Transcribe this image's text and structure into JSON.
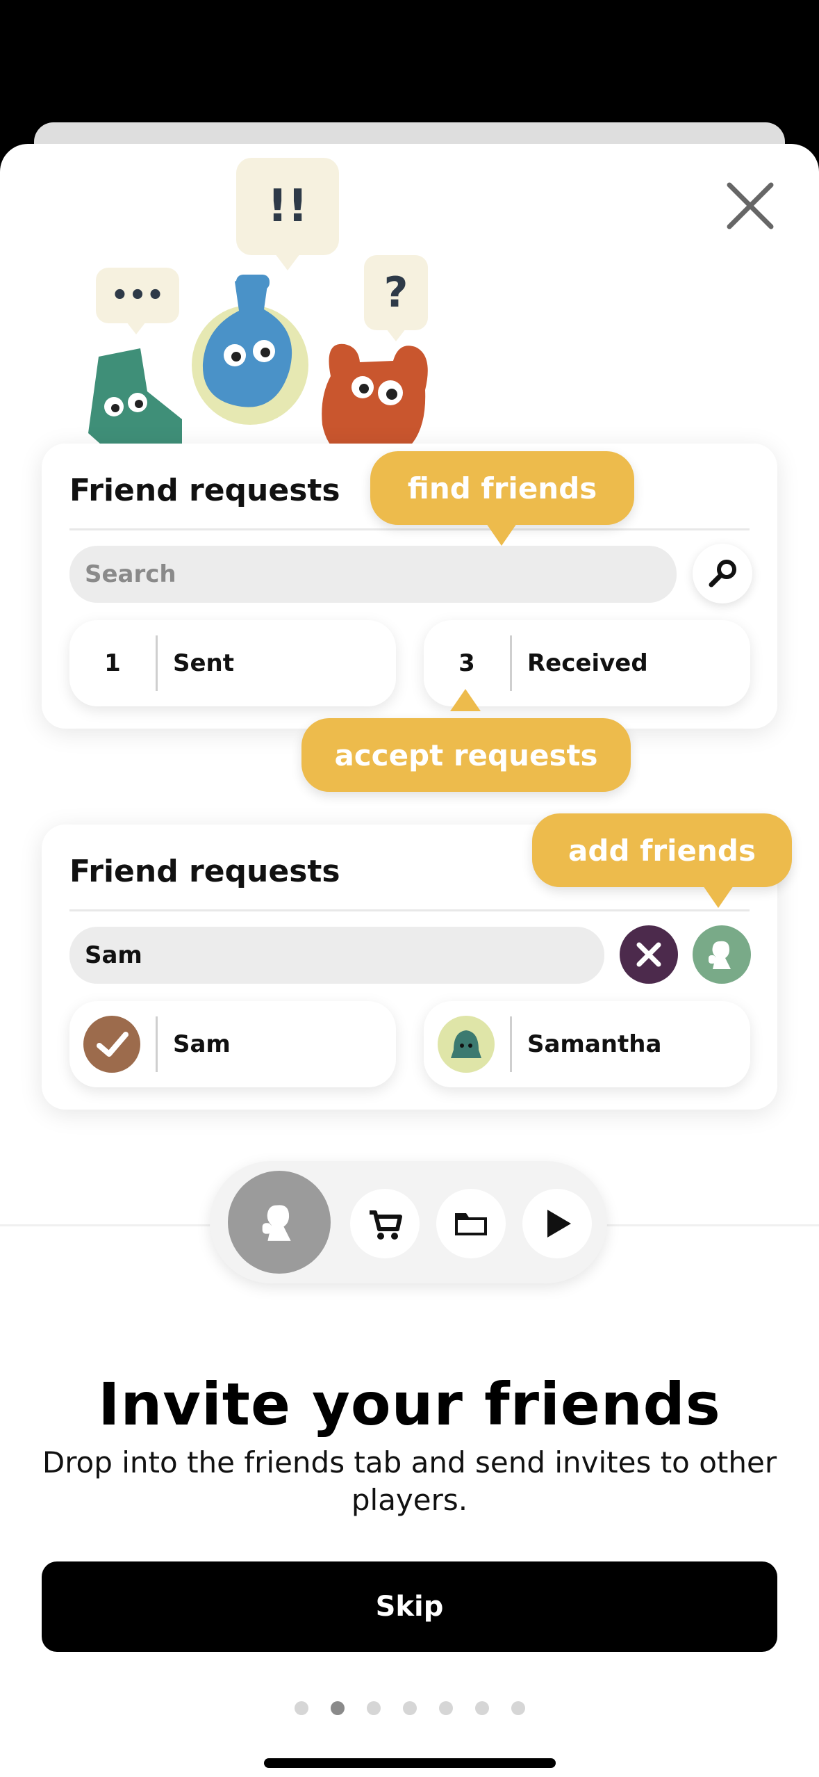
{
  "tooltips": {
    "find_friends": "find friends",
    "accept_requests": "accept requests",
    "add_friends": "add friends"
  },
  "card1": {
    "title": "Friend requests",
    "search_placeholder": "Search",
    "sent": {
      "count": "1",
      "label": "Sent"
    },
    "received": {
      "count": "3",
      "label": "Received"
    }
  },
  "card2": {
    "title": "Friend requests",
    "search_value": "Sam",
    "results": [
      {
        "name": "Sam"
      },
      {
        "name": "Samantha"
      }
    ]
  },
  "bubbles": {
    "dots": "•••",
    "exclaim": "!!",
    "question": "?"
  },
  "onboarding": {
    "heading": "Invite your friends",
    "description": "Drop into the friends tab and send invites to other players.",
    "skip_label": "Skip",
    "page_count": 7,
    "current_page": 2
  },
  "colors": {
    "accent_yellow": "#edbb4c",
    "dark_purple": "#4c2a4c",
    "friend_green": "#79aa88",
    "tab_active_grey": "#9b9b9b",
    "button_black": "#000000"
  }
}
